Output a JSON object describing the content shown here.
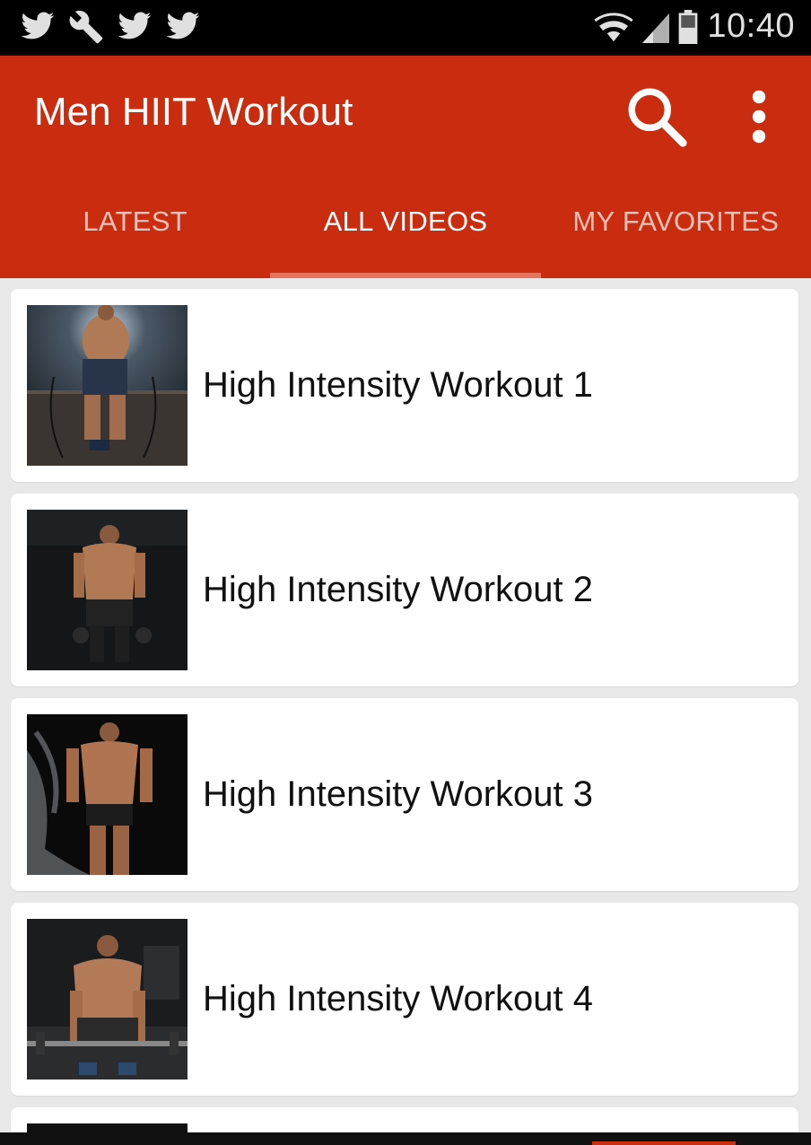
{
  "status_bar": {
    "time": "10:40",
    "notification_icons": [
      "twitter-icon",
      "wrench-icon",
      "twitter-icon",
      "twitter-icon"
    ]
  },
  "app_bar": {
    "title": "Men HIIT Workout",
    "actions": [
      "search-icon",
      "overflow-menu-icon"
    ],
    "color": "#c92c0e"
  },
  "tabs": [
    {
      "label": "LATEST",
      "active": false
    },
    {
      "label": "ALL VIDEOS",
      "active": true
    },
    {
      "label": "MY FAVORITES",
      "active": false
    }
  ],
  "videos": [
    {
      "title": "High Intensity Workout 1"
    },
    {
      "title": "High Intensity Workout 2"
    },
    {
      "title": "High Intensity Workout 3"
    },
    {
      "title": "High Intensity Workout 4"
    }
  ]
}
